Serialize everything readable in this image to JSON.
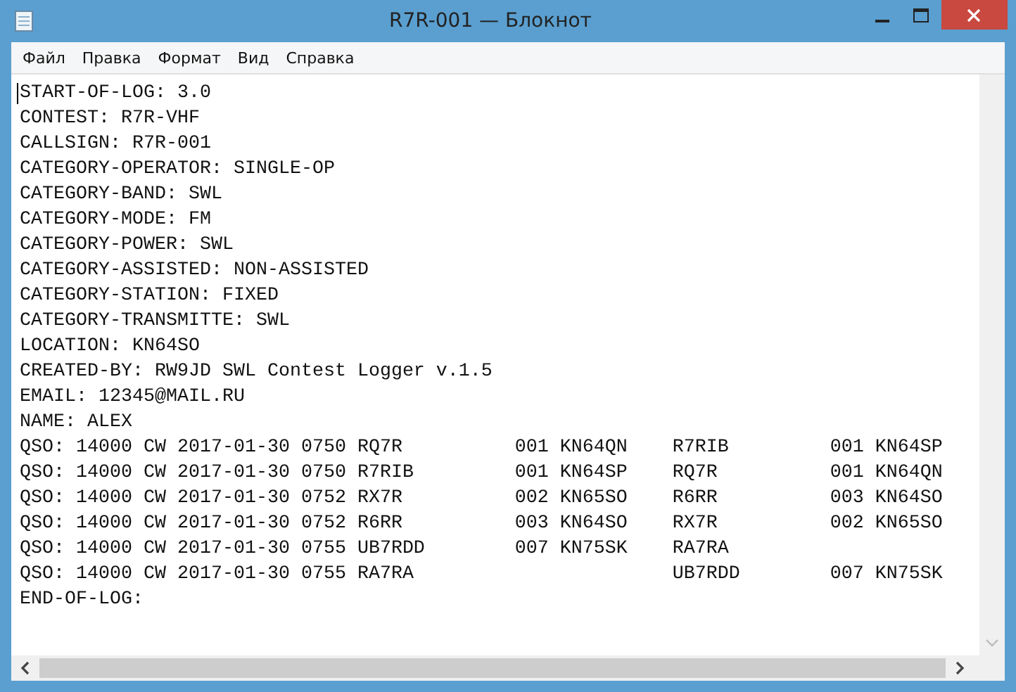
{
  "window": {
    "title": "R7R-001 — Блокнот"
  },
  "menu": [
    "Файл",
    "Правка",
    "Формат",
    "Вид",
    "Справка"
  ],
  "lines": [
    "START-OF-LOG: 3.0",
    "CONTEST: R7R-VHF",
    "CALLSIGN: R7R-001",
    "CATEGORY-OPERATOR: SINGLE-OP",
    "CATEGORY-BAND: SWL",
    "CATEGORY-MODE: FM",
    "CATEGORY-POWER: SWL",
    "CATEGORY-ASSISTED: NON-ASSISTED",
    "CATEGORY-STATION: FIXED",
    "CATEGORY-TRANSMITTE: SWL",
    "LOCATION: KN64SO",
    "CREATED-BY: RW9JD SWL Contest Logger v.1.5",
    "EMAIL: 12345@MAIL.RU",
    "NAME: ALEX",
    "QSO: 14000 CW 2017-01-30 0750 RQ7R          001 KN64QN    R7RIB         001 KN64SP",
    "QSO: 14000 CW 2017-01-30 0750 R7RIB         001 KN64SP    RQ7R          001 KN64QN",
    "QSO: 14000 CW 2017-01-30 0752 RX7R          002 KN65SO    R6RR          003 KN64SO",
    "QSO: 14000 CW 2017-01-30 0752 R6RR          003 KN64SO    RX7R          002 KN65SO",
    "QSO: 14000 CW 2017-01-30 0755 UB7RDD        007 KN75SK    RA7RA",
    "QSO: 14000 CW 2017-01-30 0755 RA7RA                       UB7RDD        007 KN75SK",
    "END-OF-LOG:"
  ]
}
